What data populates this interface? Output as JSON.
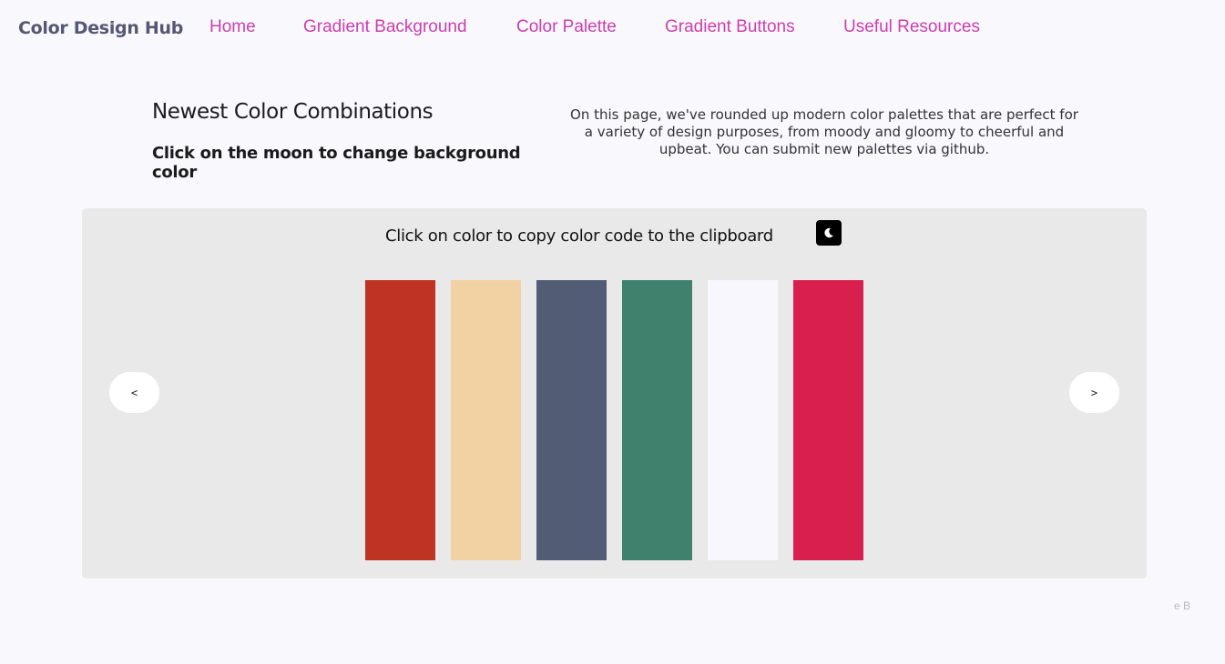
{
  "nav": {
    "brand": "Color Design Hub",
    "links": [
      {
        "label": "Home"
      },
      {
        "label": "Gradient Background"
      },
      {
        "label": "Color Palette"
      },
      {
        "label": "Gradient Buttons"
      },
      {
        "label": "Useful Resources"
      }
    ]
  },
  "intro": {
    "title": "Newest Color Combinations",
    "subtitle": "Click on the moon to change background color",
    "description": "On this page, we've rounded up modern color palettes that are perfect for a variety of design purposes, from moody and gloomy to cheerful and upbeat. You can submit new palettes via github."
  },
  "palette_panel": {
    "heading": "Click on color to copy color code to the clipboard",
    "moon_icon": "moon-icon",
    "prev_label": "<",
    "next_label": ">",
    "swatches": [
      {
        "color": "#bf3323"
      },
      {
        "color": "#f2d1a3"
      },
      {
        "color": "#525d75"
      },
      {
        "color": "#40816e"
      },
      {
        "color": "#f7f7fd"
      },
      {
        "color": "#d81f4e"
      }
    ]
  },
  "footer_fragment": "e B",
  "colors": {
    "page_background": "#f8f8fd",
    "panel_background": "#e9e9e9",
    "nav_link": "#cc3fb0",
    "brand": "#555873"
  }
}
